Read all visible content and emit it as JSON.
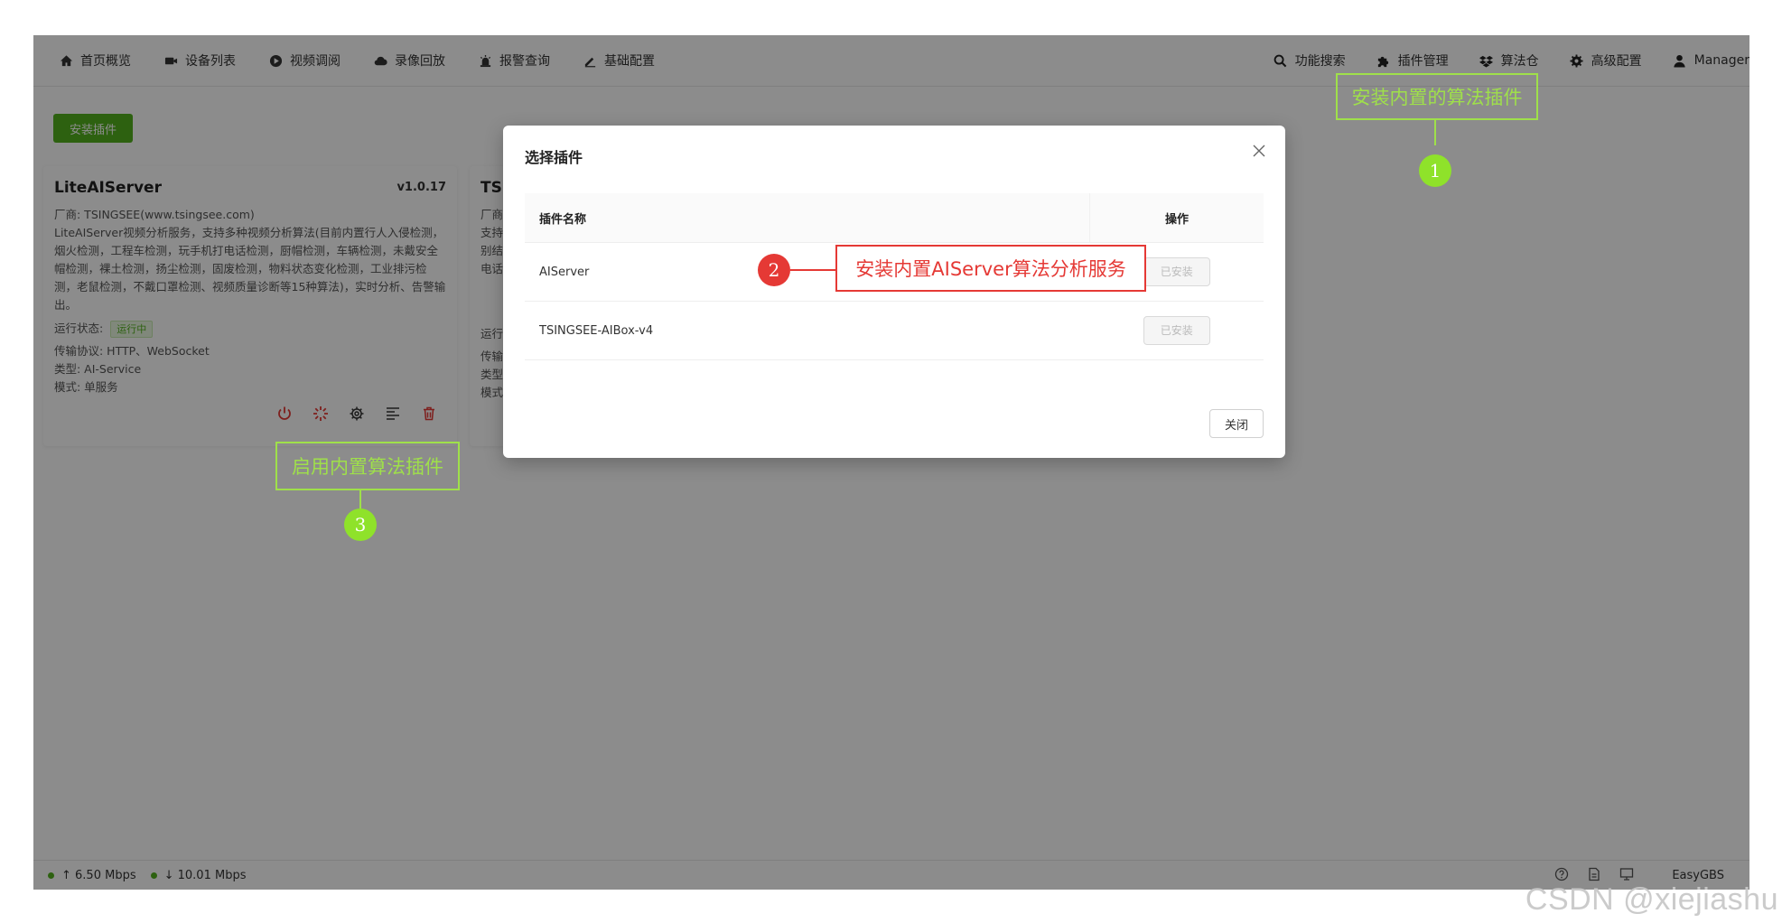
{
  "nav": {
    "left": [
      {
        "label": "首页概览",
        "icon": "home-icon"
      },
      {
        "label": "设备列表",
        "icon": "camera-icon"
      },
      {
        "label": "视频调阅",
        "icon": "play-circle-icon"
      },
      {
        "label": "录像回放",
        "icon": "cloud-icon"
      },
      {
        "label": "报警查询",
        "icon": "alarm-icon"
      },
      {
        "label": "基础配置",
        "icon": "edit-icon"
      }
    ],
    "right": [
      {
        "label": "功能搜索",
        "icon": "search-icon"
      },
      {
        "label": "插件管理",
        "icon": "puzzle-icon"
      },
      {
        "label": "算法仓",
        "icon": "dropbox-icon"
      },
      {
        "label": "高级配置",
        "icon": "gear-icon"
      },
      {
        "label": "Manager",
        "icon": "user-icon"
      }
    ]
  },
  "toolbar": {
    "install_label": "安装插件"
  },
  "cards": [
    {
      "name": "LiteAIServer",
      "version": "v1.0.17",
      "vendor": "厂商: TSINGSEE(www.tsingsee.com)",
      "description": "LiteAIServer视频分析服务，支持多种视频分析算法(目前内置行人入侵检测，烟火检测，工程车检测，玩手机打电话检测，厨帽检测，车辆检测，未戴安全帽检测，裸土检测，扬尘检测，固废检测，物料状态变化检测，工业排污检测，老鼠检测，不戴口罩检测、视频质量诊断等15种算法)，实时分析、告警输出。",
      "status_label": "运行状态:",
      "status": "运行中",
      "protocol": "传输协议: HTTP、WebSocket",
      "type": "类型: AI-Service",
      "mode": "模式: 单服务"
    },
    {
      "name": "TSI",
      "vendor": "厂商",
      "line2": "支持",
      "line3": "别结",
      "line4": "电话",
      "status_label": "运行",
      "protocol": "传输",
      "type": "类型",
      "mode": "模式"
    }
  ],
  "modal": {
    "title": "选择插件",
    "col_name": "插件名称",
    "col_op": "操作",
    "rows": [
      {
        "name": "AIServer",
        "action": "已安装"
      },
      {
        "name": "TSINGSEE-AIBox-v4",
        "action": "已安装"
      }
    ],
    "close_label": "关闭"
  },
  "statusbar": {
    "upload": "↑ 6.50 Mbps",
    "download": "↓ 10.01 Mbps",
    "product": "EasyGBS"
  },
  "annotations": {
    "n1": "1",
    "n1_text": "安装内置的算法插件",
    "n2": "2",
    "n2_text": "安装内置AIServer算法分析服务",
    "n3": "3",
    "n3_text": "启用内置算法插件"
  },
  "watermark": "CSDN @xiejiashu",
  "colors": {
    "accent": "#52b11e",
    "annotation_green": "#9fe04a",
    "annotation_red": "#e53935"
  }
}
